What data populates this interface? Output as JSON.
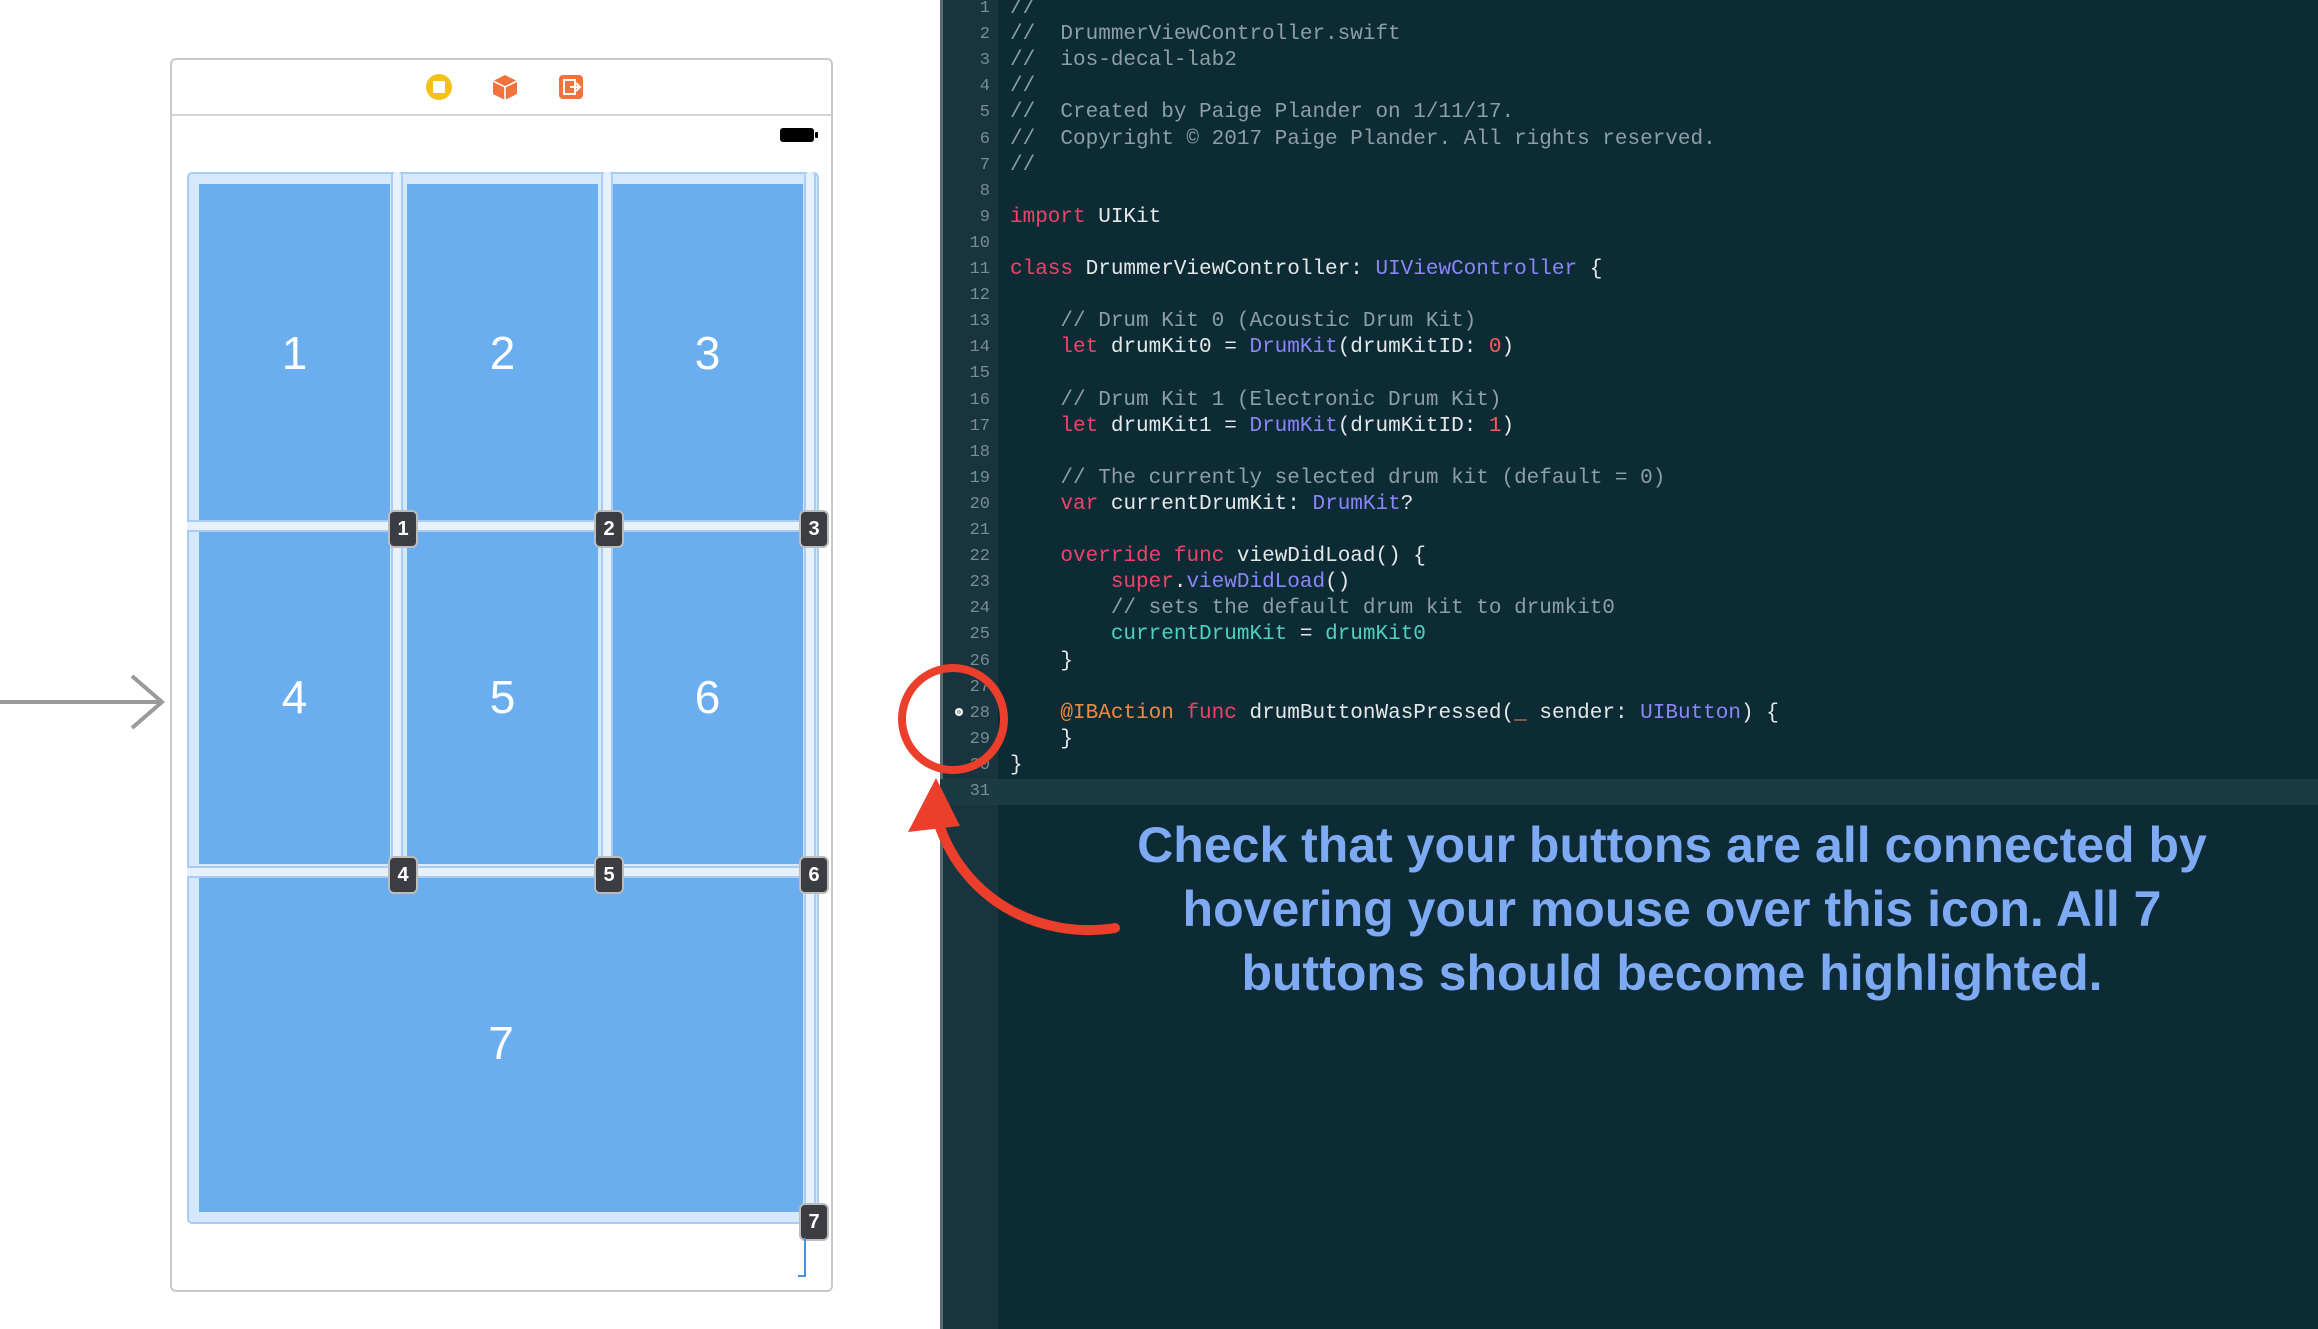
{
  "storyboard": {
    "dock_icons": [
      "view-controller-icon",
      "first-responder-icon",
      "exit-icon"
    ],
    "drum_buttons": [
      "1",
      "2",
      "3",
      "4",
      "5",
      "6",
      "7"
    ],
    "connection_badges": [
      "1",
      "2",
      "3",
      "4",
      "5",
      "6",
      "7"
    ]
  },
  "editor": {
    "lines": [
      {
        "n": "1",
        "parts": [
          {
            "t": "//",
            "c": "comment"
          }
        ]
      },
      {
        "n": "2",
        "parts": [
          {
            "t": "//  DrummerViewController.swift",
            "c": "comment"
          }
        ]
      },
      {
        "n": "3",
        "parts": [
          {
            "t": "//  ios-decal-lab2",
            "c": "comment"
          }
        ]
      },
      {
        "n": "4",
        "parts": [
          {
            "t": "//",
            "c": "comment"
          }
        ]
      },
      {
        "n": "5",
        "parts": [
          {
            "t": "//  Created by Paige Plander on 1/11/17.",
            "c": "comment"
          }
        ]
      },
      {
        "n": "6",
        "parts": [
          {
            "t": "//  Copyright © 2017 Paige Plander. All rights reserved.",
            "c": "comment"
          }
        ]
      },
      {
        "n": "7",
        "parts": [
          {
            "t": "//",
            "c": "comment"
          }
        ]
      },
      {
        "n": "8",
        "parts": []
      },
      {
        "n": "9",
        "parts": [
          {
            "t": "import",
            "c": "keyword"
          },
          {
            "t": " UIKit",
            "c": "plain"
          }
        ]
      },
      {
        "n": "10",
        "parts": []
      },
      {
        "n": "11",
        "parts": [
          {
            "t": "class",
            "c": "keyword"
          },
          {
            "t": " DrummerViewController: ",
            "c": "plain"
          },
          {
            "t": "UIViewController",
            "c": "type"
          },
          {
            "t": " {",
            "c": "plain"
          }
        ]
      },
      {
        "n": "12",
        "parts": []
      },
      {
        "n": "13",
        "parts": [
          {
            "t": "    // Drum Kit 0 (Acoustic Drum Kit)",
            "c": "comment"
          }
        ]
      },
      {
        "n": "14",
        "parts": [
          {
            "t": "    ",
            "c": "plain"
          },
          {
            "t": "let",
            "c": "keyword"
          },
          {
            "t": " drumKit0 = ",
            "c": "plain"
          },
          {
            "t": "DrumKit",
            "c": "type"
          },
          {
            "t": "(drumKitID: ",
            "c": "plain"
          },
          {
            "t": "0",
            "c": "num"
          },
          {
            "t": ")",
            "c": "plain"
          }
        ]
      },
      {
        "n": "15",
        "parts": []
      },
      {
        "n": "16",
        "parts": [
          {
            "t": "    // Drum Kit 1 (Electronic Drum Kit)",
            "c": "comment"
          }
        ]
      },
      {
        "n": "17",
        "parts": [
          {
            "t": "    ",
            "c": "plain"
          },
          {
            "t": "let",
            "c": "keyword"
          },
          {
            "t": " drumKit1 = ",
            "c": "plain"
          },
          {
            "t": "DrumKit",
            "c": "type"
          },
          {
            "t": "(drumKitID: ",
            "c": "plain"
          },
          {
            "t": "1",
            "c": "num"
          },
          {
            "t": ")",
            "c": "plain"
          }
        ]
      },
      {
        "n": "18",
        "parts": []
      },
      {
        "n": "19",
        "parts": [
          {
            "t": "    // The currently selected drum kit (default = 0)",
            "c": "comment"
          }
        ]
      },
      {
        "n": "20",
        "parts": [
          {
            "t": "    ",
            "c": "plain"
          },
          {
            "t": "var",
            "c": "keyword"
          },
          {
            "t": " currentDrumKit: ",
            "c": "plain"
          },
          {
            "t": "DrumKit",
            "c": "type"
          },
          {
            "t": "?",
            "c": "plain"
          }
        ]
      },
      {
        "n": "21",
        "parts": []
      },
      {
        "n": "22",
        "parts": [
          {
            "t": "    ",
            "c": "plain"
          },
          {
            "t": "override",
            "c": "keyword"
          },
          {
            "t": " ",
            "c": "plain"
          },
          {
            "t": "func",
            "c": "keyword"
          },
          {
            "t": " viewDidLoad() {",
            "c": "plain"
          }
        ]
      },
      {
        "n": "23",
        "parts": [
          {
            "t": "        ",
            "c": "plain"
          },
          {
            "t": "super",
            "c": "keyword"
          },
          {
            "t": ".",
            "c": "plain"
          },
          {
            "t": "viewDidLoad",
            "c": "call"
          },
          {
            "t": "()",
            "c": "plain"
          }
        ]
      },
      {
        "n": "24",
        "parts": [
          {
            "t": "        // sets the default drum kit to drumkit0",
            "c": "comment"
          }
        ]
      },
      {
        "n": "25",
        "parts": [
          {
            "t": "        ",
            "c": "plain"
          },
          {
            "t": "currentDrumKit",
            "c": "var"
          },
          {
            "t": " = ",
            "c": "plain"
          },
          {
            "t": "drumKit0",
            "c": "var"
          }
        ]
      },
      {
        "n": "26",
        "parts": [
          {
            "t": "    }",
            "c": "plain"
          }
        ]
      },
      {
        "n": "27",
        "parts": []
      },
      {
        "n": "28",
        "parts": [
          {
            "t": "    ",
            "c": "plain"
          },
          {
            "t": "@IBAction",
            "c": "attr"
          },
          {
            "t": " ",
            "c": "plain"
          },
          {
            "t": "func",
            "c": "keyword"
          },
          {
            "t": " drumButtonWasPressed(",
            "c": "plain"
          },
          {
            "t": "_",
            "c": "attr"
          },
          {
            "t": " sender: ",
            "c": "plain"
          },
          {
            "t": "UIButton",
            "c": "type"
          },
          {
            "t": ") {",
            "c": "plain"
          }
        ]
      },
      {
        "n": "29",
        "parts": [
          {
            "t": "    }",
            "c": "plain"
          }
        ]
      },
      {
        "n": "30",
        "parts": [
          {
            "t": "}",
            "c": "plain"
          }
        ]
      },
      {
        "n": "31",
        "parts": [],
        "current": true
      }
    ]
  },
  "annotation": {
    "text_lines": [
      "Check that your buttons are all connected by",
      "hovering your mouse over this icon. All 7",
      "buttons should become highlighted."
    ],
    "color": "#7eaaf3",
    "highlight_color": "#ec3f2b"
  }
}
